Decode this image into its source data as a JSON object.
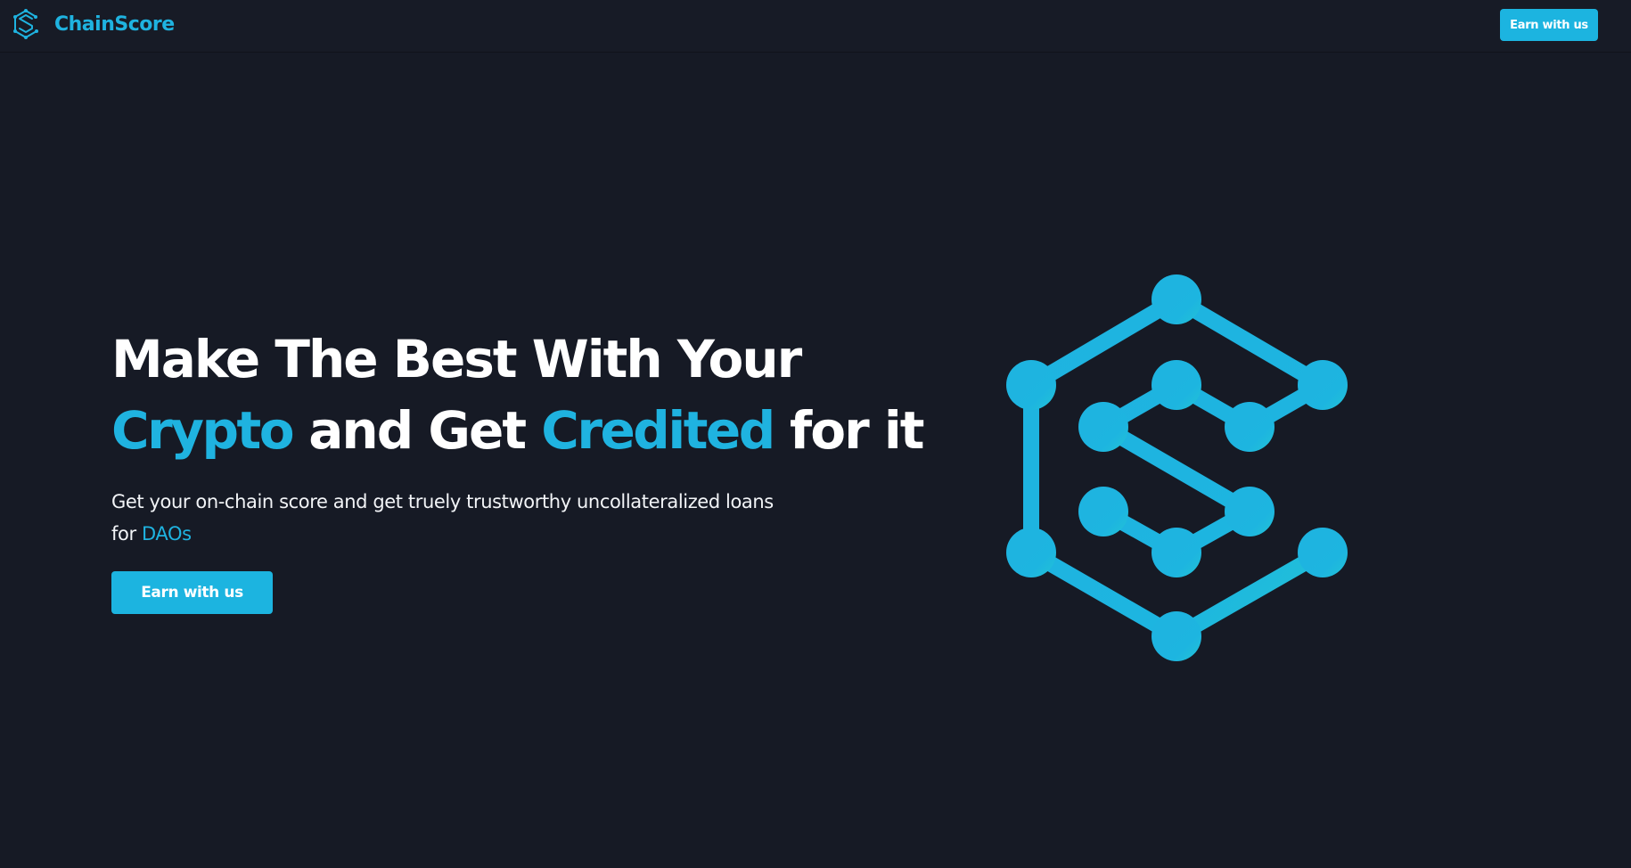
{
  "brand": {
    "name": "ChainScore",
    "icon": "chainscore-logo-icon"
  },
  "nav": {
    "cta_label": "Earn with us"
  },
  "hero": {
    "heading": {
      "line1": "Make The Best With Your",
      "word1": "Crypto",
      "mid": "and Get",
      "word2": "Credited",
      "tail": "for it"
    },
    "subtitle": {
      "text": "Get your on-chain score and get truely trustworthy uncollateralized loans for",
      "highlight": "DAOs"
    },
    "cta_label": "Earn with us",
    "graphic_icon": "chain-network-s-icon"
  },
  "colors": {
    "background": "#161a25",
    "accent": "#1fb3e0",
    "button": "#1cb4e0",
    "text": "#ffffff"
  }
}
